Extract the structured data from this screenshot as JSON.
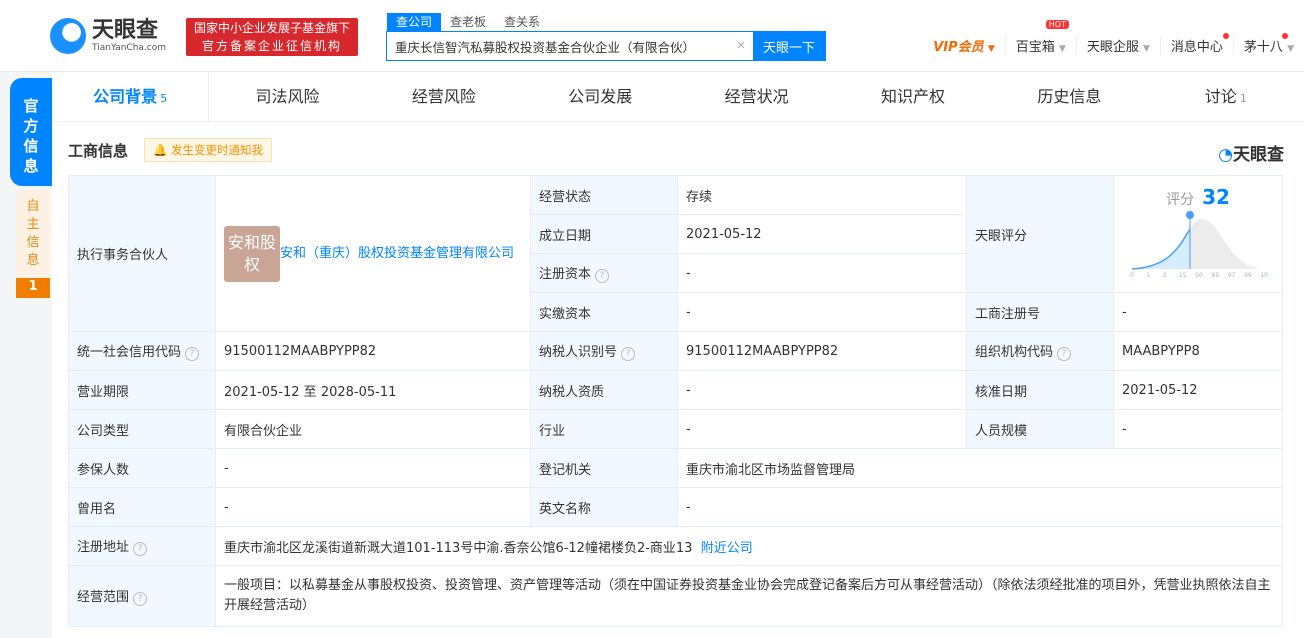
{
  "header": {
    "logo_cn": "天眼查",
    "logo_en": "TianYanCha.com",
    "badge_line1": "国家中小企业发展子基金旗下",
    "badge_line2": "官方备案企业征信机构",
    "search_tabs": [
      "查公司",
      "查老板",
      "查关系"
    ],
    "search_value": "重庆长信智汽私募股权投资基金合伙企业（有限合伙）",
    "search_button": "天眼一下",
    "nav": {
      "vip": "VIP会员",
      "baibaoxiang": "百宝箱",
      "hot": "HOT",
      "enterprise": "天眼企服",
      "messages": "消息中心",
      "user": "茅十八"
    }
  },
  "side": {
    "official": "官方信息",
    "self": "自主信息",
    "self_count": "1"
  },
  "tabs": [
    {
      "label": "公司背景",
      "count": "5"
    },
    {
      "label": "司法风险"
    },
    {
      "label": "经营风险"
    },
    {
      "label": "公司发展"
    },
    {
      "label": "经营状况"
    },
    {
      "label": "知识产权"
    },
    {
      "label": "历史信息"
    },
    {
      "label": "讨论",
      "count": "1"
    }
  ],
  "section": {
    "title": "工商信息",
    "notify": "发生变更时通知我",
    "brand": "天眼查"
  },
  "info": {
    "partner_label": "执行事务合伙人",
    "partner_avatar": "安和股权",
    "partner_name": "安和（重庆）股权投资基金管理有限公司",
    "status_label": "经营状态",
    "status": "存续",
    "founded_label": "成立日期",
    "founded": "2021-05-12",
    "reg_cap_label": "注册资本",
    "reg_cap": "-",
    "paid_cap_label": "实缴资本",
    "paid_cap": "-",
    "score_label": "天眼评分",
    "score_title": "评分",
    "score": "32",
    "score_ticks": [
      "0",
      "1",
      "3",
      "15",
      "50",
      "85",
      "97",
      "99",
      "100"
    ],
    "reg_no_label": "工商注册号",
    "reg_no": "-",
    "credit_label": "统一社会信用代码",
    "credit": "91500112MAABPYPP82",
    "tax_id_label": "纳税人识别号",
    "tax_id": "91500112MAABPYPP82",
    "org_label": "组织机构代码",
    "org": "MAABPYPP8",
    "term_label": "营业期限",
    "term": "2021-05-12  至 2028-05-11",
    "tax_qual_label": "纳税人资质",
    "tax_qual": "-",
    "approve_label": "核准日期",
    "approve": "2021-05-12",
    "type_label": "公司类型",
    "type": "有限合伙企业",
    "industry_label": "行业",
    "industry": "-",
    "staff_label": "人员规模",
    "staff": "-",
    "insured_label": "参保人数",
    "insured": "-",
    "authority_label": "登记机关",
    "authority": "重庆市渝北区市场监督管理局",
    "former_label": "曾用名",
    "former": "-",
    "en_label": "英文名称",
    "en": "-",
    "address_label": "注册地址",
    "address": "重庆市渝北区龙溪街道新溉大道101-113号中渝.香奈公馆6-12幢裙楼负2-商业13",
    "nearby": "附近公司",
    "scope_label": "经营范围",
    "scope": "一般项目：以私募基金从事股权投资、投资管理、资产管理等活动（须在中国证券投资基金业协会完成登记备案后方可从事经营活动）（除依法须经批准的项目外，凭营业执照依法自主开展经营活动）"
  }
}
